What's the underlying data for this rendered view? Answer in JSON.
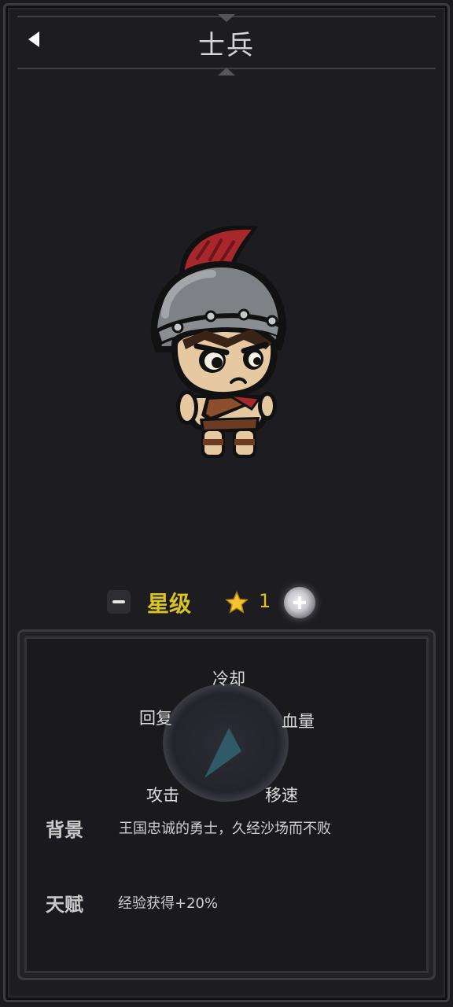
{
  "header": {
    "title": "士兵"
  },
  "star": {
    "label": "星级",
    "value": "1"
  },
  "radar": {
    "labels": {
      "top": "冷却",
      "top_left": "回复",
      "top_right": "血量",
      "bottom_left": "攻击",
      "bottom_right": "移速"
    }
  },
  "info": {
    "background_key": "背景",
    "background_value": "王国忠诚的勇士，久经沙场而不败",
    "talent_key": "天赋",
    "talent_value": "经验获得+20%"
  },
  "colors": {
    "accent_yellow": "#d9c420",
    "panel_bg": "#1a191d",
    "radar_fill": "#2f5a68"
  },
  "icons": {
    "back": "back-arrow-icon",
    "star": "star-icon",
    "minus": "minus-icon",
    "plus": "plus-icon"
  }
}
